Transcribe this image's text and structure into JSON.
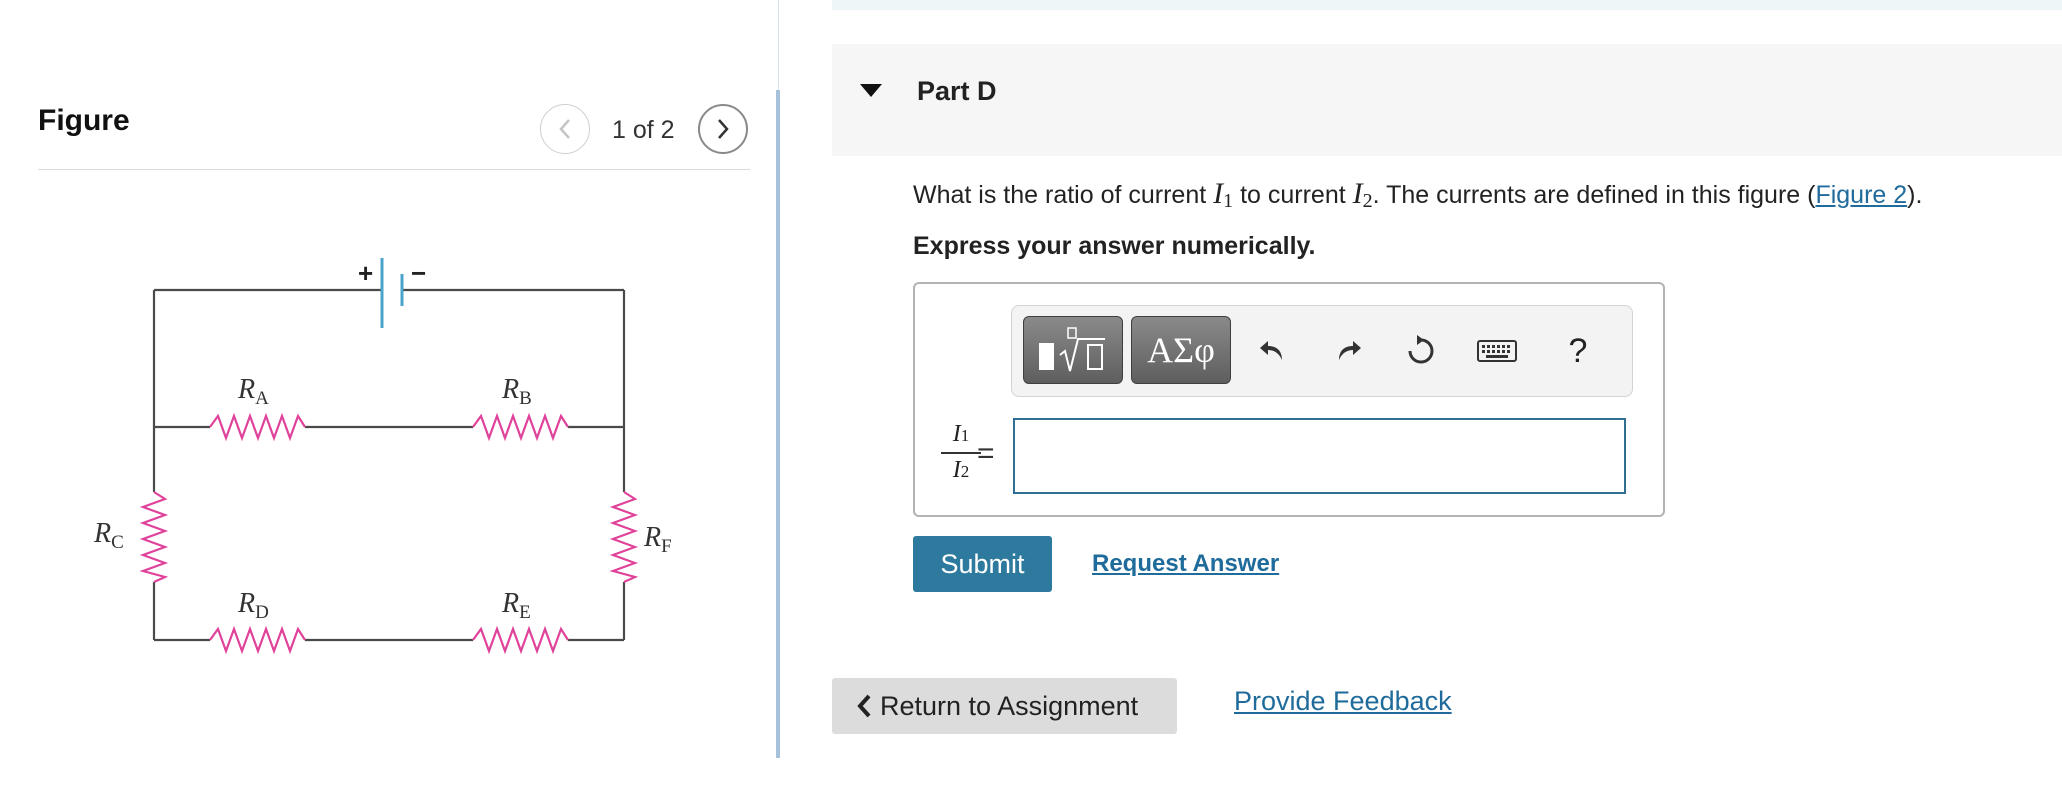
{
  "figure_panel": {
    "title": "Figure",
    "pager": {
      "count_text": "1 of 2"
    }
  },
  "circuit": {
    "battery_plus": "+",
    "battery_minus": "−",
    "resistors": [
      {
        "letter": "R",
        "subscript": "A"
      },
      {
        "letter": "R",
        "subscript": "B"
      },
      {
        "letter": "R",
        "subscript": "C"
      },
      {
        "letter": "R",
        "subscript": "D"
      },
      {
        "letter": "R",
        "subscript": "E"
      },
      {
        "letter": "R",
        "subscript": "F"
      }
    ],
    "colors": {
      "wire": "#4a4a4a",
      "resistor": "#e0429a",
      "battery": "#4aa3c8"
    }
  },
  "part": {
    "title": "Part D"
  },
  "question": {
    "text_1": "What is the ratio of current ",
    "var_1": "I",
    "sub_1": "1",
    "text_2": " to current ",
    "var_2": "I",
    "sub_2": "2",
    "text_3": ". The currents are defined in this figure (",
    "link": "Figure 2",
    "text_4": ")."
  },
  "instruction": "Express your answer numerically.",
  "answer": {
    "lhs_numerator_var": "I",
    "lhs_numerator_sub": "1",
    "lhs_denominator_var": "I",
    "lhs_denominator_sub": "2",
    "equals": "=",
    "input_value": "",
    "toolbar": {
      "greek_label": "ΑΣφ",
      "help_label": "?",
      "icons": [
        "templates-icon",
        "greek-letters-icon",
        "undo-icon",
        "redo-icon",
        "reset-icon",
        "keyboard-icon",
        "help-icon"
      ]
    }
  },
  "actions": {
    "submit_label": "Submit",
    "request_answer_label": "Request Answer",
    "return_label": "Return to Assignment",
    "feedback_label": "Provide Feedback"
  },
  "colors": {
    "accent": "#2e7a9e",
    "link": "#1f6b9b",
    "input_border": "#2e6f93"
  }
}
